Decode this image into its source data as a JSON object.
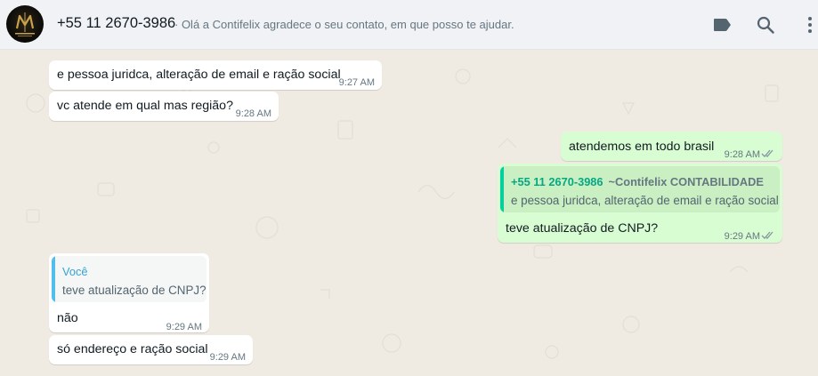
{
  "header": {
    "contact_name": "+55 11 2670-3986",
    "status": "· Olá a Contifelix agradece o seu contato, em que posso te ajudar.",
    "icons": [
      "label-icon",
      "search-icon",
      "menu-icon"
    ]
  },
  "messages": [
    {
      "direction": "in",
      "text": "e pessoa juridca, alteração de email e ração social",
      "time": "9:27 AM"
    },
    {
      "direction": "in",
      "text": "vc atende em qual mas região?",
      "time": "9:28 AM"
    },
    {
      "direction": "out",
      "text": "atendemos em todo brasil",
      "time": "9:28 AM",
      "status": "read"
    },
    {
      "direction": "out",
      "quote": {
        "author": "+55 11 2670-3986",
        "author_sub": "~Contifelix CONTABILIDADE",
        "text": "e pessoa juridca, alteração de email e ração social"
      },
      "text": "teve atualização de CNPJ?",
      "time": "9:29 AM",
      "status": "read"
    },
    {
      "direction": "in",
      "quote": {
        "author": "Você",
        "text": "teve atualização de CNPJ?"
      },
      "text": "não",
      "time": "9:29 AM"
    },
    {
      "direction": "in",
      "text": "só endereço e ração social",
      "time": "9:29 AM"
    }
  ],
  "colors": {
    "chat_bg": "#efeae2",
    "incoming_bubble": "#ffffff",
    "outgoing_bubble": "#d9fdd3",
    "quote_self_bar": "#53bdeb",
    "quote_other_bar": "#06cf9c",
    "read_tick": "#8696a0"
  }
}
